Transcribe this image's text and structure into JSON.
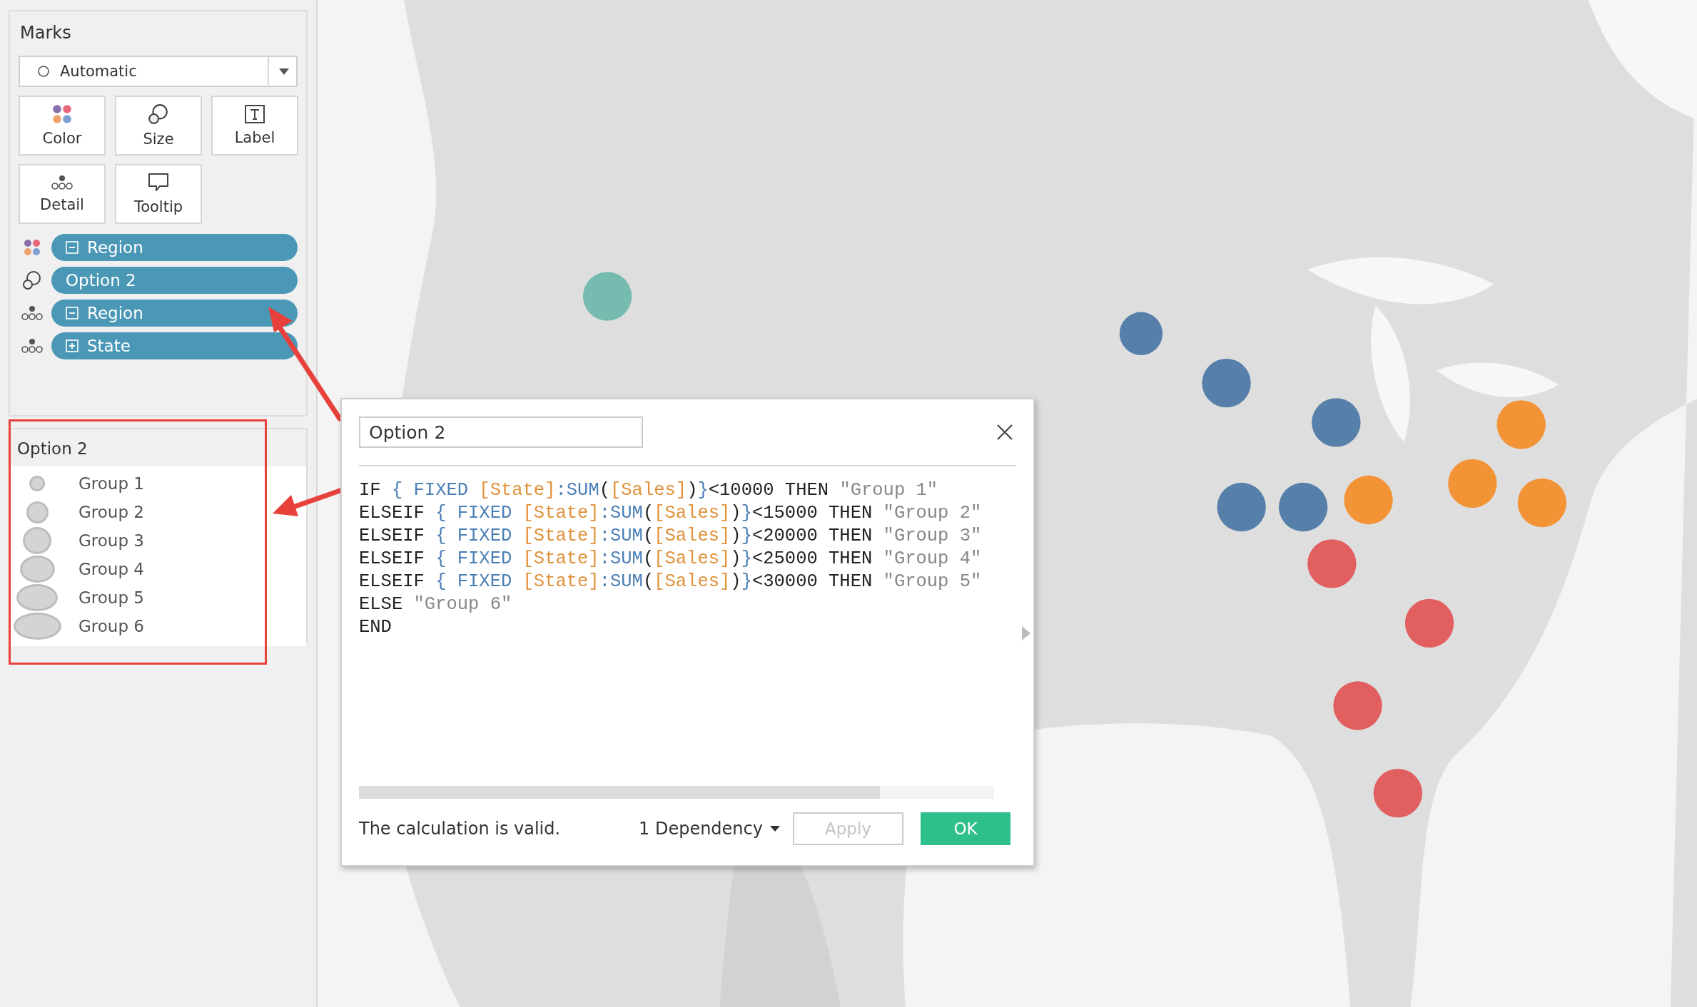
{
  "marks": {
    "title": "Marks",
    "mark_type": "Automatic",
    "buttons": [
      {
        "kind": "color",
        "label": "Color"
      },
      {
        "kind": "size",
        "label": "Size"
      },
      {
        "kind": "label",
        "label": "Label"
      },
      {
        "kind": "detail",
        "label": "Detail"
      },
      {
        "kind": "tooltip",
        "label": "Tooltip"
      }
    ],
    "shelf": [
      {
        "kind": "color",
        "expanded": true,
        "label": "Region"
      },
      {
        "kind": "size",
        "label": "Option 2"
      },
      {
        "kind": "detail",
        "expanded": true,
        "label": "Region"
      },
      {
        "kind": "detail",
        "expanded": false,
        "label": "State"
      }
    ]
  },
  "legend": {
    "title": "Option 2",
    "items": [
      "Group 1",
      "Group 2",
      "Group 3",
      "Group 4",
      "Group 5",
      "Group 6"
    ]
  },
  "dialog": {
    "name": "Option 2",
    "code": [
      [
        {
          "kind": "kw",
          "t": "IF "
        },
        {
          "kind": "fn",
          "t": "{ FIXED "
        },
        {
          "kind": "field",
          "t": "[State]"
        },
        {
          "kind": "fn",
          "t": ":SUM"
        },
        {
          "kind": "kw",
          "t": "("
        },
        {
          "kind": "field",
          "t": "[Sales]"
        },
        {
          "kind": "kw",
          "t": ")"
        },
        {
          "kind": "fn",
          "t": "}"
        },
        {
          "kind": "kw",
          "t": "<10000 THEN "
        },
        {
          "kind": "str",
          "t": "\"Group 1\""
        }
      ],
      [
        {
          "kind": "kw",
          "t": "ELSEIF "
        },
        {
          "kind": "fn",
          "t": "{ FIXED "
        },
        {
          "kind": "field",
          "t": "[State]"
        },
        {
          "kind": "fn",
          "t": ":SUM"
        },
        {
          "kind": "kw",
          "t": "("
        },
        {
          "kind": "field",
          "t": "[Sales]"
        },
        {
          "kind": "kw",
          "t": ")"
        },
        {
          "kind": "fn",
          "t": "}"
        },
        {
          "kind": "kw",
          "t": "<15000 THEN "
        },
        {
          "kind": "str",
          "t": "\"Group 2\""
        }
      ],
      [
        {
          "kind": "kw",
          "t": "ELSEIF "
        },
        {
          "kind": "fn",
          "t": "{ FIXED "
        },
        {
          "kind": "field",
          "t": "[State]"
        },
        {
          "kind": "fn",
          "t": ":SUM"
        },
        {
          "kind": "kw",
          "t": "("
        },
        {
          "kind": "field",
          "t": "[Sales]"
        },
        {
          "kind": "kw",
          "t": ")"
        },
        {
          "kind": "fn",
          "t": "}"
        },
        {
          "kind": "kw",
          "t": "<20000 THEN "
        },
        {
          "kind": "str",
          "t": "\"Group 3\""
        }
      ],
      [
        {
          "kind": "kw",
          "t": "ELSEIF "
        },
        {
          "kind": "fn",
          "t": "{ FIXED "
        },
        {
          "kind": "field",
          "t": "[State]"
        },
        {
          "kind": "fn",
          "t": ":SUM"
        },
        {
          "kind": "kw",
          "t": "("
        },
        {
          "kind": "field",
          "t": "[Sales]"
        },
        {
          "kind": "kw",
          "t": ")"
        },
        {
          "kind": "fn",
          "t": "}"
        },
        {
          "kind": "kw",
          "t": "<25000 THEN "
        },
        {
          "kind": "str",
          "t": "\"Group 4\""
        }
      ],
      [
        {
          "kind": "kw",
          "t": "ELSEIF "
        },
        {
          "kind": "fn",
          "t": "{ FIXED "
        },
        {
          "kind": "field",
          "t": "[State]"
        },
        {
          "kind": "fn",
          "t": ":SUM"
        },
        {
          "kind": "kw",
          "t": "("
        },
        {
          "kind": "field",
          "t": "[Sales]"
        },
        {
          "kind": "kw",
          "t": ")"
        },
        {
          "kind": "fn",
          "t": "}"
        },
        {
          "kind": "kw",
          "t": "<30000 THEN "
        },
        {
          "kind": "str",
          "t": "\"Group 5\""
        }
      ],
      [
        {
          "kind": "kw",
          "t": "ELSE "
        },
        {
          "kind": "str",
          "t": "\"Group 6\""
        }
      ],
      [
        {
          "kind": "kw",
          "t": "END"
        }
      ]
    ],
    "status": "The calculation is valid.",
    "dependency": "1 Dependency",
    "apply": {
      "label": "Apply",
      "disabled": true
    },
    "ok": "OK"
  }
}
